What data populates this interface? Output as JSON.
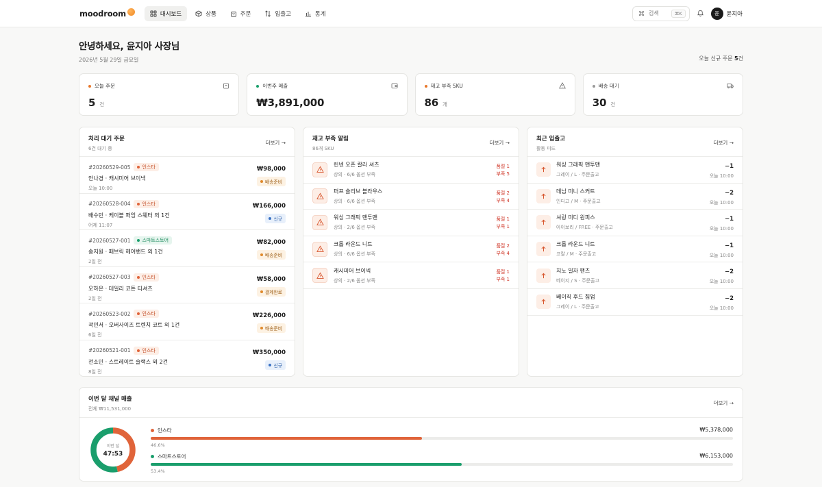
{
  "brand": "moodroom",
  "nav": [
    {
      "label": "대시보드",
      "icon": "grid-icon",
      "active": true
    },
    {
      "label": "상품",
      "icon": "box-icon"
    },
    {
      "label": "주문",
      "icon": "bag-icon"
    },
    {
      "label": "입출고",
      "icon": "arrows-updown-icon"
    },
    {
      "label": "통계",
      "icon": "bar-chart-icon"
    }
  ],
  "search": {
    "label": "검색",
    "shortcut": "⌘K"
  },
  "user": {
    "initial": "윤",
    "name": "윤지아"
  },
  "greeting": {
    "title": "안녕하세요, 윤지아 사장님",
    "date": "2026년 5월 29일 금요일",
    "new_orders_prefix": "오늘 신규 주문 ",
    "new_orders_count": "5",
    "new_orders_suffix": "건"
  },
  "stats": [
    {
      "label": "오늘 주문",
      "value": "5",
      "unit": "건",
      "color": "#e8782c",
      "icon": "bag-icon"
    },
    {
      "label": "이번주 매출",
      "value": "₩3,891,000",
      "unit": "",
      "color": "#1aa06b",
      "icon": "wallet-icon"
    },
    {
      "label": "재고 부족 SKU",
      "value": "86",
      "unit": "개",
      "color": "#e8782c",
      "icon": "warning-icon"
    },
    {
      "label": "배송 대기",
      "value": "30",
      "unit": "건",
      "color": "#9a9a9a",
      "icon": "truck-icon"
    }
  ],
  "orders_panel": {
    "title": "처리 대기 주문",
    "sub": "6건 대기 중",
    "more": "더보기 →",
    "orders": [
      {
        "id": "#20260529-005",
        "channel": "인스타",
        "channel_type": "insta",
        "name": "안나경 · 캐시미어 브이넥",
        "time": "오늘 10:00",
        "amount": "₩98,000",
        "status": "배송준비",
        "status_type": "prep"
      },
      {
        "id": "#20260528-004",
        "channel": "인스타",
        "channel_type": "insta",
        "name": "배수민 · 케이블 퍼잉 스웨터 외 1건",
        "time": "어제 11:07",
        "amount": "₩166,000",
        "status": "신규",
        "status_type": "new"
      },
      {
        "id": "#20260527-001",
        "channel": "스마트스토어",
        "channel_type": "smart",
        "name": "송지원 · 패브릭 헤어밴드 외 1건",
        "time": "2일 전",
        "amount": "₩82,000",
        "status": "배송준비",
        "status_type": "prep"
      },
      {
        "id": "#20260527-003",
        "channel": "인스타",
        "channel_type": "insta",
        "name": "오하은 · 데일리 코튼 티셔츠",
        "time": "2일 전",
        "amount": "₩58,000",
        "status": "결제완료",
        "status_type": "paid"
      },
      {
        "id": "#20260523-002",
        "channel": "인스타",
        "channel_type": "insta",
        "name": "곽민서 · 오버사이즈 트렌치 코트 외 1건",
        "time": "6일 전",
        "amount": "₩226,000",
        "status": "배송준비",
        "status_type": "prep"
      },
      {
        "id": "#20260521-001",
        "channel": "인스타",
        "channel_type": "insta",
        "name": "전소민 · 스트레이트 슬랙스 외 2건",
        "time": "8일 전",
        "amount": "₩350,000",
        "status": "신규",
        "status_type": "new"
      }
    ]
  },
  "stock_panel": {
    "title": "재고 부족 알림",
    "sub": "86개 SKU",
    "more": "더보기 →",
    "items": [
      {
        "name": "린넨 오픈 칼라 셔츠",
        "sub": "상의 · 6/6 옵션 부족",
        "out": "품절 1",
        "low": "부족 5"
      },
      {
        "name": "퍼프 슬리브 블라우스",
        "sub": "상의 · 6/6 옵션 부족",
        "out": "품절 2",
        "low": "부족 4"
      },
      {
        "name": "워싱 그래픽 맨투맨",
        "sub": "상의 · 2/6 옵션 부족",
        "out": "품절 1",
        "low": "부족 1"
      },
      {
        "name": "크롭 라운드 니트",
        "sub": "상의 · 6/6 옵션 부족",
        "out": "품절 2",
        "low": "부족 4"
      },
      {
        "name": "캐시미어 브이넥",
        "sub": "상의 · 2/6 옵션 부족",
        "out": "품절 1",
        "low": "부족 1"
      }
    ]
  },
  "io_panel": {
    "title": "최근 입출고",
    "sub": "활동 피드",
    "more": "더보기 →",
    "items": [
      {
        "name": "워싱 그래픽 맨투맨",
        "sub": "그레이 / L · 주문출고",
        "qty": "−1",
        "time": "오늘 10:00"
      },
      {
        "name": "데님 미니 스커트",
        "sub": "인디고 / M · 주문출고",
        "qty": "−2",
        "time": "오늘 10:00"
      },
      {
        "name": "셔링 미디 원피스",
        "sub": "아이보리 / FREE · 주문출고",
        "qty": "−1",
        "time": "오늘 10:00"
      },
      {
        "name": "크롭 라운드 니트",
        "sub": "코랄 / M · 주문출고",
        "qty": "−1",
        "time": "오늘 10:00"
      },
      {
        "name": "치노 일자 팬츠",
        "sub": "베이지 / S · 주문출고",
        "qty": "−2",
        "time": "오늘 10:00"
      },
      {
        "name": "베이직 후드 집업",
        "sub": "그레이 / L · 주문출고",
        "qty": "−2",
        "time": "오늘 10:00"
      }
    ]
  },
  "revenue": {
    "title": "이번 달 채널 매출",
    "sub": "전체 ₩11,531,000",
    "more": "더보기 →",
    "donut_caption": "이번 달",
    "donut_value": "47:53",
    "channels": [
      {
        "name": "인스타",
        "amount": "₩5,378,000",
        "pct_label": "46.6%",
        "pct": 46.6,
        "color": "#e0643a"
      },
      {
        "name": "스마트스토어",
        "amount": "₩6,153,000",
        "pct_label": "53.4%",
        "pct": 53.4,
        "color": "#1a9e6c"
      }
    ]
  }
}
